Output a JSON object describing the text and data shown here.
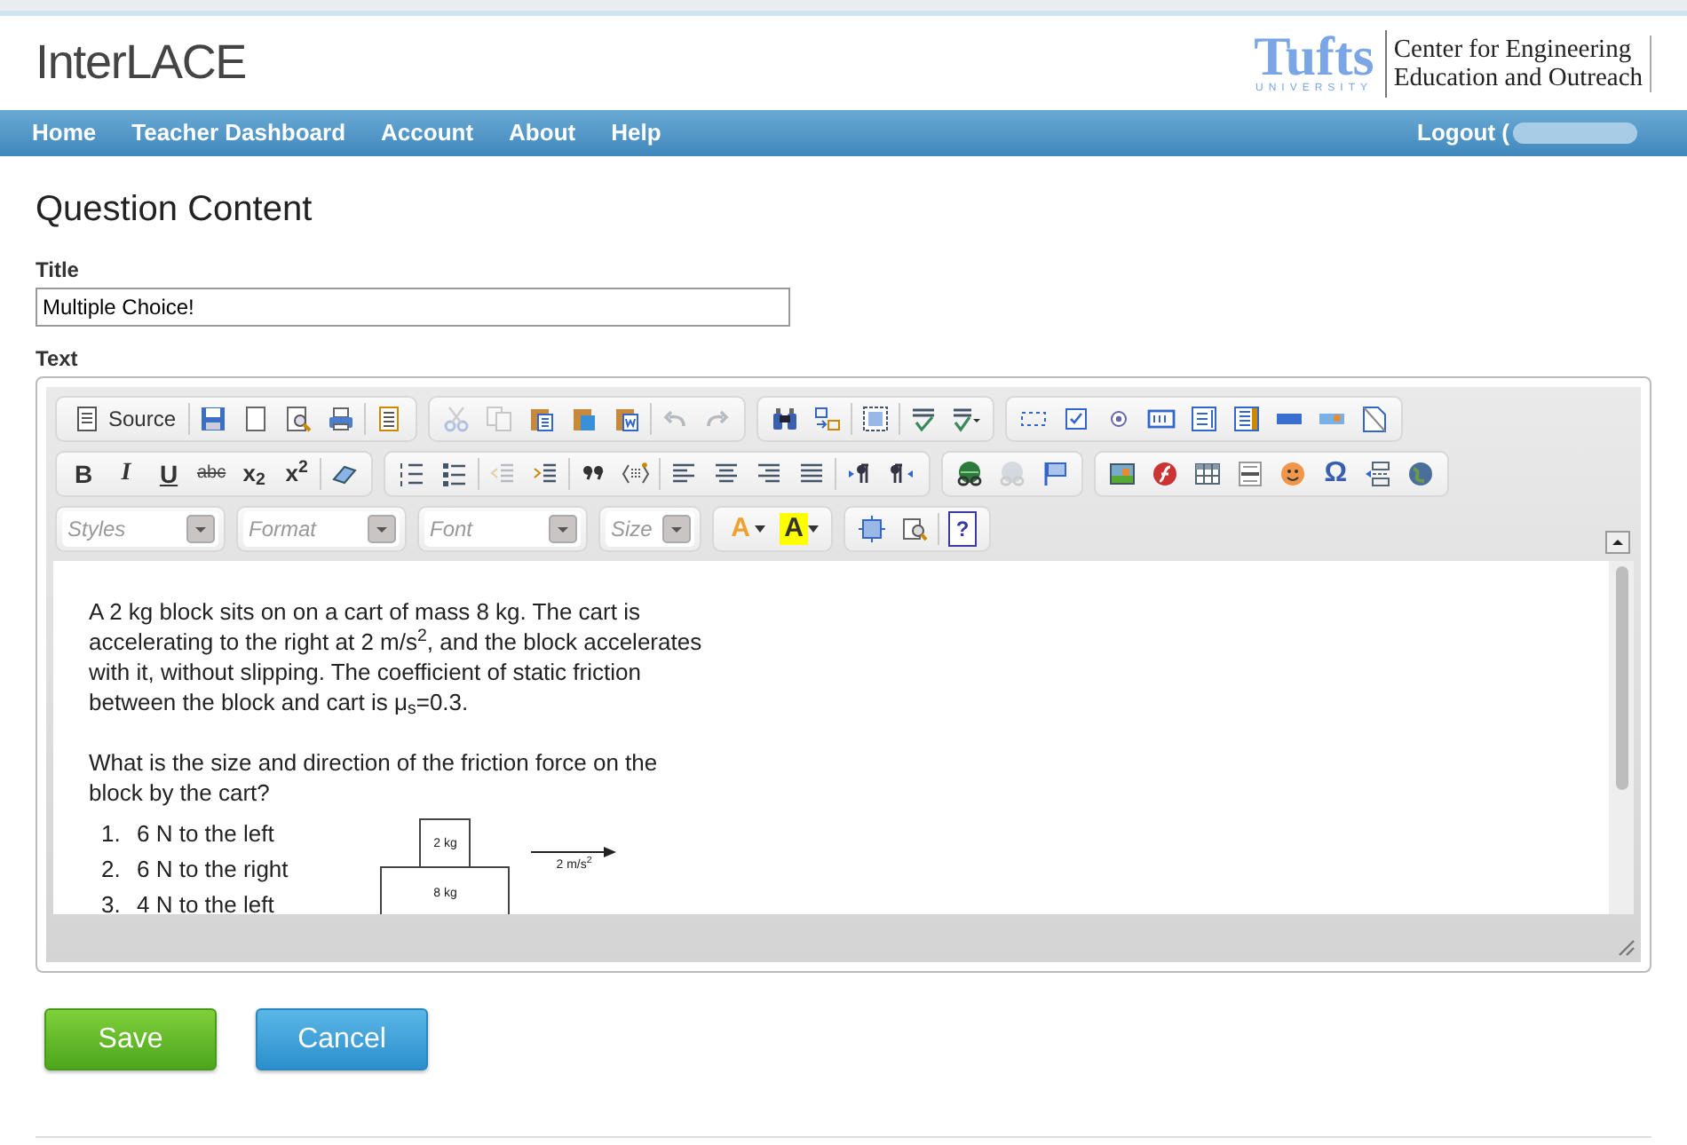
{
  "header": {
    "app_title": "InterLACE",
    "logo": {
      "wordmark": "Tufts",
      "sub": "UNIVERSITY",
      "center_lines": [
        "Center for Engineering",
        "Education and Outreach"
      ]
    }
  },
  "nav": {
    "items": [
      {
        "label": "Home"
      },
      {
        "label": "Teacher Dashboard"
      },
      {
        "label": "Account"
      },
      {
        "label": "About"
      },
      {
        "label": "Help"
      }
    ],
    "logout": "Logout ("
  },
  "page_title": "Question Content",
  "title_field": {
    "label": "Title",
    "value": "Multiple Choice!"
  },
  "text_label": "Text",
  "toolbar": {
    "rows": [
      [
        [
          [
            {
              "kind": "source",
              "label": "Source"
            }
          ],
          [
            {
              "kind": "save"
            },
            {
              "kind": "newpage"
            },
            {
              "kind": "preview"
            },
            {
              "kind": "print"
            }
          ],
          [
            {
              "kind": "templates"
            }
          ]
        ],
        [
          [
            {
              "kind": "cut",
              "disabled": true
            },
            {
              "kind": "copy",
              "disabled": true
            },
            {
              "kind": "paste",
              "disabled": false
            },
            {
              "kind": "pastetext",
              "disabled": false
            },
            {
              "kind": "pasteword",
              "disabled": false
            }
          ],
          [
            {
              "kind": "undo",
              "disabled": true
            },
            {
              "kind": "redo",
              "disabled": true
            }
          ]
        ],
        [
          [
            {
              "kind": "find"
            },
            {
              "kind": "replace"
            }
          ],
          [
            {
              "kind": "selectall"
            }
          ],
          [
            {
              "kind": "spell"
            },
            {
              "kind": "spellmenu"
            }
          ]
        ],
        [
          [
            {
              "kind": "form"
            },
            {
              "kind": "checkbox"
            },
            {
              "kind": "radio"
            },
            {
              "kind": "textfield"
            },
            {
              "kind": "textarea"
            },
            {
              "kind": "select"
            },
            {
              "kind": "button"
            },
            {
              "kind": "imagebutton"
            },
            {
              "kind": "hidden"
            }
          ]
        ]
      ],
      [
        [
          [
            {
              "kind": "bold",
              "label": "B"
            },
            {
              "kind": "italic",
              "label": "I"
            },
            {
              "kind": "underline",
              "label": "U"
            },
            {
              "kind": "strike",
              "label": "abc"
            },
            {
              "kind": "subscript",
              "label": "x$_{2}$"
            },
            {
              "kind": "superscript",
              "label": "x$^{2}$"
            }
          ],
          [
            {
              "kind": "eraser"
            }
          ]
        ],
        [
          [
            {
              "kind": "numlist"
            },
            {
              "kind": "bullist"
            }
          ],
          [
            {
              "kind": "outdent",
              "disabled": true
            },
            {
              "kind": "indent",
              "disabled": false
            }
          ],
          [
            {
              "kind": "quote"
            },
            {
              "kind": "div"
            }
          ],
          [
            {
              "kind": "left"
            },
            {
              "kind": "center"
            },
            {
              "kind": "right"
            },
            {
              "kind": "justify"
            }
          ],
          [
            {
              "kind": "ltr"
            },
            {
              "kind": "rtl"
            }
          ]
        ],
        [
          [
            {
              "kind": "link",
              "disabled": false
            },
            {
              "kind": "unlink",
              "disabled": true
            },
            {
              "kind": "anchor",
              "disabled": false
            }
          ]
        ],
        [
          [
            {
              "kind": "image"
            },
            {
              "kind": "flash"
            },
            {
              "kind": "table"
            },
            {
              "kind": "hr"
            },
            {
              "kind": "smiley"
            },
            {
              "kind": "omega",
              "label": "Ω"
            },
            {
              "kind": "pagebreak"
            },
            {
              "kind": "iframe"
            }
          ]
        ]
      ]
    ],
    "combos": [
      {
        "placeholder": "Styles"
      },
      {
        "placeholder": "Format"
      },
      {
        "placeholder": "Font"
      },
      {
        "placeholder": "Size"
      }
    ],
    "row3_groups": [
      [
        [
          {
            "kind": "textcolor",
            "label": "A"
          },
          {
            "kind": "bgcolor",
            "label": "A"
          }
        ]
      ],
      [
        [
          {
            "kind": "maximize"
          },
          {
            "kind": "showblocks"
          }
        ],
        [
          {
            "kind": "help",
            "label": "?"
          }
        ]
      ]
    ]
  },
  "content": {
    "paragraphs": [
      "A 2 kg block sits on on a cart of mass 8 kg.  The cart is accelerating to the right at 2 m/s$^{2}$, and the block accelerates with it, without slipping.  The coefficient of static friction between the block and cart is μ$_{s}$=0.3.",
      "What is the size and direction of the friction force on the block by the cart?"
    ],
    "choices": [
      {
        "number": "1.",
        "text": "6 N to the left"
      },
      {
        "number": "2.",
        "text": "6 N to the right"
      },
      {
        "number": "3.",
        "text": "4 N to the left"
      }
    ],
    "diagram": {
      "block_label": "2 kg",
      "cart_label": "8 kg",
      "arrow_label": "2 m/s$^{2}$"
    }
  },
  "buttons": [
    {
      "kind": "save",
      "label": "Save"
    },
    {
      "kind": "cancel",
      "label": "Cancel"
    }
  ]
}
